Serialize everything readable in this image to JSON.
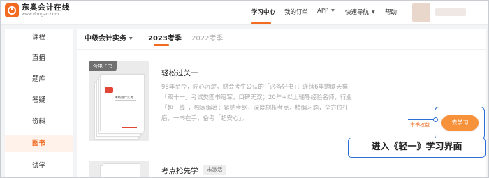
{
  "header": {
    "logo_title": "东奥会计在线",
    "logo_url": "www.dongao.com",
    "nav": [
      {
        "label": "学习中心",
        "active": true
      },
      {
        "label": "我的订单",
        "active": false
      },
      {
        "label": "APP",
        "has_caret": true
      },
      {
        "label": "快速导航",
        "has_caret": true
      },
      {
        "label": "帮助",
        "active": false
      }
    ],
    "caret": "▼"
  },
  "sidebar": {
    "items": [
      {
        "label": "课程"
      },
      {
        "label": "直播"
      },
      {
        "label": "题库"
      },
      {
        "label": "答疑"
      },
      {
        "label": "资料"
      },
      {
        "label": "图书",
        "active": true
      },
      {
        "label": "试学"
      }
    ]
  },
  "main": {
    "subject": "中级会计实务",
    "tabs": [
      {
        "label": "2023考季",
        "active": true
      },
      {
        "label": "2022考季",
        "active": false
      }
    ],
    "books": [
      {
        "tag": "含电子书",
        "cover_title": "中级会计实务",
        "title": "轻松过关一",
        "description": "98年至今，匠心沉淀，财会考生公认的「必备好书」；连续6年蝉联天猫「双十一」考试类图书冠军，口碑无双；20年+以上辅导经验名师，行业「超一线」，独家编著；紧贴考纲，深度剖析考点，精编习题，全方位打磨，一书在手，备考「超安心」。",
        "rights_link": "本书权益",
        "action_button": "去学习"
      },
      {
        "title": "考点抢先学",
        "badge": "未激活"
      }
    ],
    "callout": "进入《轻一》学习界面"
  },
  "colors": {
    "accent": "#f26b21",
    "button": "#f7923a",
    "annotation": "#2c6fd8"
  }
}
